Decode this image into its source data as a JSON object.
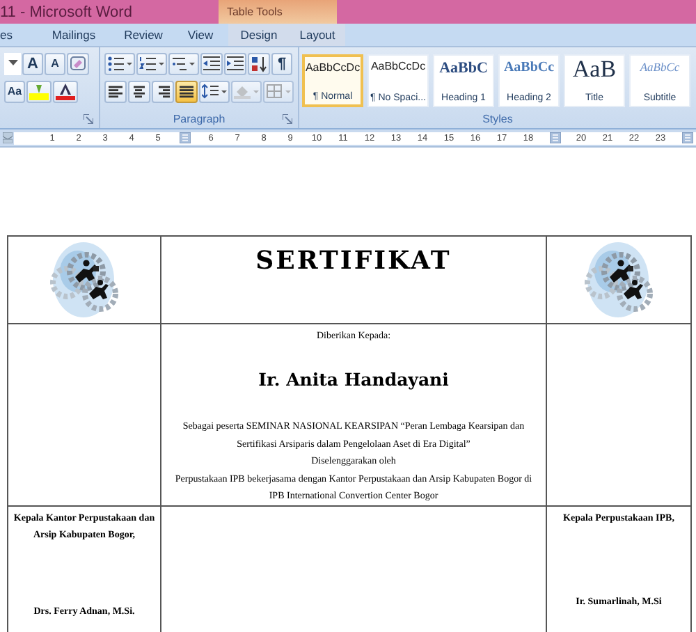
{
  "window": {
    "title": "11 - Microsoft Word",
    "context_tab_group": "Table Tools"
  },
  "tabs": [
    {
      "label": "es",
      "selected": false,
      "contextual": false
    },
    {
      "label": "Mailings",
      "selected": false,
      "contextual": false
    },
    {
      "label": "Review",
      "selected": false,
      "contextual": false
    },
    {
      "label": "View",
      "selected": false,
      "contextual": false
    },
    {
      "label": "Design",
      "selected": false,
      "contextual": true
    },
    {
      "label": "Layout",
      "selected": false,
      "contextual": true
    }
  ],
  "font_group": {
    "grow_label": "A",
    "shrink_label": "A",
    "case_label": "Aa"
  },
  "paragraph_group": {
    "label": "Paragraph",
    "pilcrow": "¶",
    "alignments": [
      {
        "kind": "left",
        "selected": false
      },
      {
        "kind": "center",
        "selected": false
      },
      {
        "kind": "right",
        "selected": false
      },
      {
        "kind": "justify",
        "selected": true
      }
    ]
  },
  "styles_group": {
    "label": "Styles",
    "styles": [
      {
        "kind": "normal",
        "preview": "AaBbCcDc",
        "label": "¶ Normal",
        "selected": true
      },
      {
        "kind": "nospacing",
        "preview": "AaBbCcDc",
        "label": "¶ No Spaci...",
        "selected": false
      },
      {
        "kind": "heading1",
        "preview": "AaBbC",
        "label": "Heading 1",
        "selected": false
      },
      {
        "kind": "heading2",
        "preview": "AaBbCc",
        "label": "Heading 2",
        "selected": false
      },
      {
        "kind": "title",
        "preview": "AaB",
        "label": "Title",
        "selected": false
      },
      {
        "kind": "subtitle",
        "preview": "AaBbCc",
        "label": "Subtitle",
        "selected": false
      }
    ]
  },
  "ruler": [
    {
      "kind": "number",
      "label": "1"
    },
    {
      "kind": "number",
      "label": "2"
    },
    {
      "kind": "number",
      "label": "3"
    },
    {
      "kind": "number",
      "label": "4"
    },
    {
      "kind": "number",
      "label": "5"
    },
    {
      "kind": "marker"
    },
    {
      "kind": "number",
      "label": "6"
    },
    {
      "kind": "number",
      "label": "7"
    },
    {
      "kind": "number",
      "label": "8"
    },
    {
      "kind": "number",
      "label": "9"
    },
    {
      "kind": "number",
      "label": "10"
    },
    {
      "kind": "number",
      "label": "11"
    },
    {
      "kind": "number",
      "label": "12"
    },
    {
      "kind": "number",
      "label": "13"
    },
    {
      "kind": "number",
      "label": "14"
    },
    {
      "kind": "number",
      "label": "15"
    },
    {
      "kind": "number",
      "label": "16"
    },
    {
      "kind": "number",
      "label": "17"
    },
    {
      "kind": "number",
      "label": "18"
    },
    {
      "kind": "marker"
    },
    {
      "kind": "number",
      "label": "20"
    },
    {
      "kind": "number",
      "label": "21"
    },
    {
      "kind": "number",
      "label": "22"
    },
    {
      "kind": "number",
      "label": "23"
    },
    {
      "kind": "marker"
    }
  ],
  "certificate": {
    "title": "SERTIFIKAT",
    "given_to": "Diberikan Kepada:",
    "recipient": "Ir. Anita Handayani",
    "body": [
      "Sebagai peserta SEMINAR NASIONAL KEARSIPAN “Peran Lembaga Kearsipan dan Sertifikasi Arsiparis dalam Pengelolaan Aset di Era Digital”",
      "Diselenggarakan oleh",
      "Perpustakaan IPB bekerjasama dengan Kantor Perpustakaan dan Arsip Kabupaten Bogor di IPB International Convertion Center Bogor"
    ],
    "left_signer": {
      "position": "Kepala Kantor Perpustakaan dan Arsip Kabupaten Bogor,",
      "name": "Drs. Ferry Adnan, M.Si."
    },
    "right_signer": {
      "position": "Kepala Perpustakaan IPB,",
      "name": "Ir. Sumarlinah, M.Si"
    }
  }
}
